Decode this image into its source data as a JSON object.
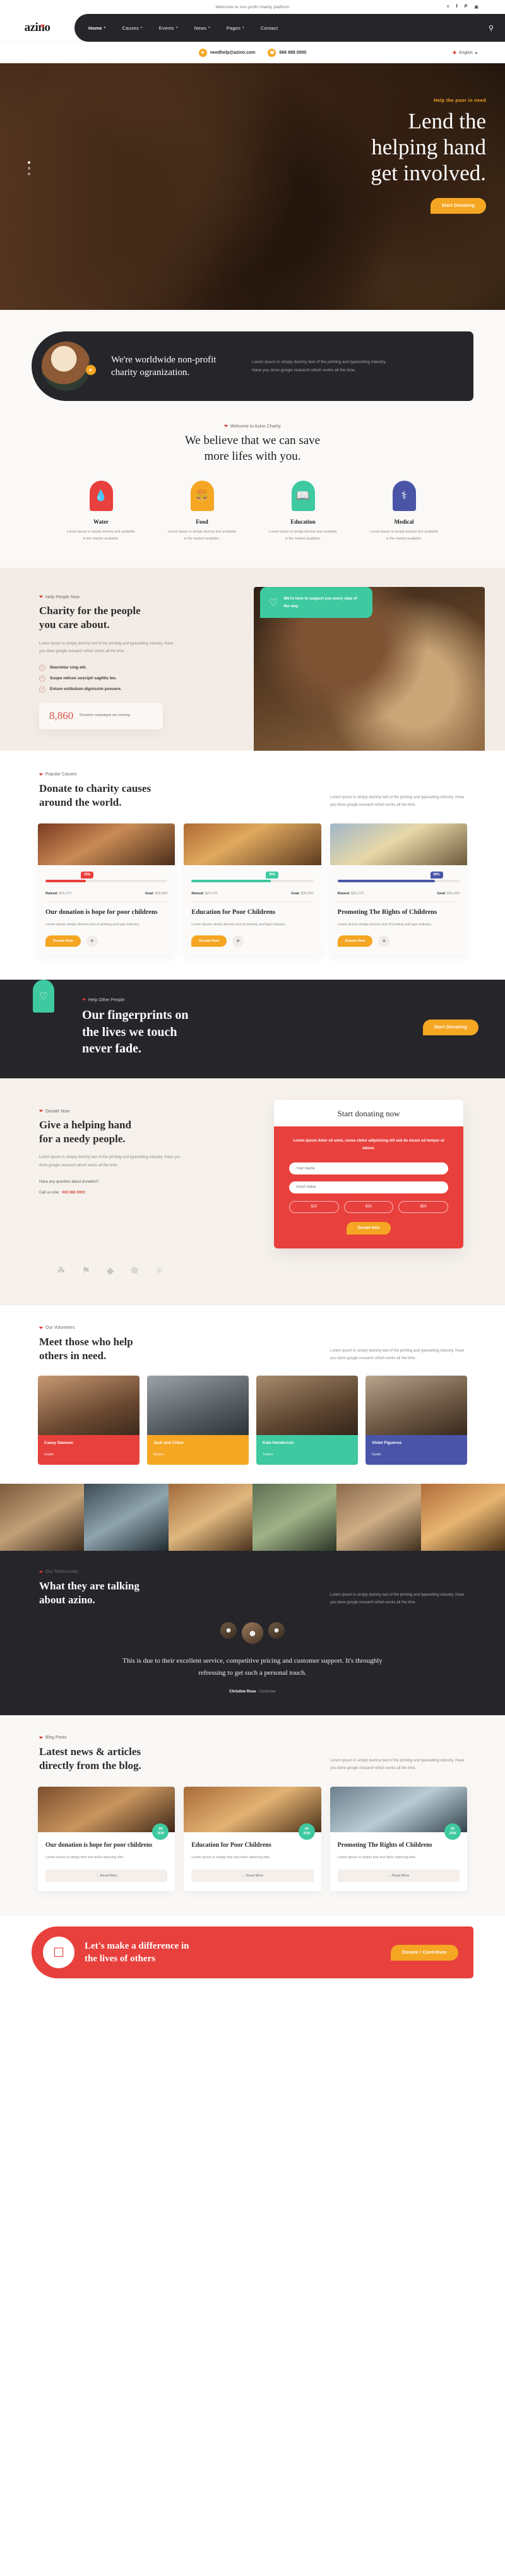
{
  "topbar": {
    "welcome": "Welcome to non profit charity platform",
    "socials": [
      {
        "name": "twitter-icon",
        "glyph": "ᴠ"
      },
      {
        "name": "facebook-icon",
        "glyph": "f"
      },
      {
        "name": "pinterest-icon",
        "glyph": "P"
      },
      {
        "name": "instagram-icon",
        "glyph": "▣"
      }
    ]
  },
  "brand": {
    "name": "azino"
  },
  "nav": {
    "items": [
      {
        "label": "Home",
        "caret": "⌄",
        "active": true
      },
      {
        "label": "Causes",
        "caret": "⌄",
        "active": false
      },
      {
        "label": "Events",
        "caret": "⌄",
        "active": false
      },
      {
        "label": "News",
        "caret": "⌄",
        "active": false
      },
      {
        "label": "Pages",
        "caret": "⌄",
        "active": false
      },
      {
        "label": "Contact",
        "caret": "",
        "active": false
      }
    ],
    "search_icon": "⌕"
  },
  "infobar": {
    "email": "needhelp@azino.com",
    "phone": "666 888 0000",
    "email_icon": "✉",
    "phone_icon": "☎",
    "language": "English",
    "lang_caret": "⌄"
  },
  "hero": {
    "eyebrow": "Help the poor in need",
    "title_line1": "Lend the",
    "title_line2": "helping hand",
    "title_line3": "get involved.",
    "cta": "Start Donating"
  },
  "about": {
    "title": "We're worldwide non-profit charity ogranization.",
    "text": "Lorem Ipsum is simply dummy text of the printing and typesetting industry. Have you done google research which works all the time.",
    "badge_icon": "▶"
  },
  "services": {
    "eyebrow": "Welcome to Azino Charity",
    "title_line1": "We believe that we can save",
    "title_line2": "more lifes with you.",
    "items": [
      {
        "label": "Water",
        "icon": "Ὂ7",
        "color": "#e8403c",
        "desc": "Lorem Ipsum is simply dummy text available in the market available."
      },
      {
        "label": "Food",
        "icon": "ἵ4",
        "color": "#f5a623",
        "desc": "Lorem Ipsum is simply dummy text available in the market available."
      },
      {
        "label": "Education",
        "icon": "Ὅ6",
        "color": "#3ec9a0",
        "desc": "Lorem Ipsum is simply dummy text available in the market available."
      },
      {
        "label": "Medical",
        "icon": "⚕",
        "color": "#4a55a8",
        "desc": "Lorem Ipsum is simply dummy text available in the market available."
      }
    ]
  },
  "charity": {
    "eyebrow": "Help People Now",
    "title_line1": "Charity for the people",
    "title_line2": "you care about.",
    "lead": "Lorem Ipsum is simply dummy text of the printing and typesetting industry. Have you done google research which works all the time.",
    "ticks": [
      "Nsectetur cing elit.",
      "Suspe ndisse suscipit sagittis leo.",
      "Entum estibulum dignissim posuere."
    ],
    "tick_icon": "✓",
    "stat_number": "8,860",
    "stat_label": "Donation campaigns are running",
    "green_text": "We're here to support you every step of the way.",
    "green_icon": "♡"
  },
  "causes": {
    "eyebrow": "Popular Causes",
    "title_line1": "Donate to charity causes",
    "title_line2": "around the world.",
    "headtext": "Lorem Ipsum is simply dummy text of the printing and typesetting industry. Have you done google research which works all the time.",
    "raised_label": "Raised:",
    "goal_label": "Goal:",
    "donate_label": "Donate Now",
    "share_icon": "⛓",
    "cards": [
      {
        "title": "Our donation is hope for poor childrens",
        "desc": "Lorem Ipsum simply dummy text of printing and type industry.",
        "percent": "33%",
        "percent_value": 33,
        "raised": "$25,270",
        "goal": "$30,000",
        "color": "#e8403c"
      },
      {
        "title": "Education for Poor Childrens",
        "desc": "Lorem Ipsum simply dummy text of printing and type industry.",
        "percent": "65%",
        "percent_value": 65,
        "raised": "$25,270",
        "goal": "$30,000",
        "color": "#3ec9a0"
      },
      {
        "title": "Promoting The Rights of Childrens",
        "desc": "Lorem Ipsum simply dummy text of printing and type industry.",
        "percent": "80%",
        "percent_value": 80,
        "raised": "$25,270",
        "goal": "$30,000",
        "color": "#4a55a8"
      }
    ]
  },
  "fingerprints": {
    "eyebrow": "Help Other People",
    "title_line1": "Our fingerprints on",
    "title_line2": "the lives we touch",
    "title_line3": "never fade.",
    "cta": "Start Donating",
    "icon": "ὤc"
  },
  "donate": {
    "eyebrow": "Donate Now",
    "title_line1": "Give a helping hand",
    "title_line2": "for a needy people.",
    "lead": "Lorem Ipsum is simply dummy text of the printing and typesetting industry. Have you done google research which works all the time.",
    "question": "Have any question about donation?",
    "call_prefix": "Call us now",
    "call_number": "666 888 0000",
    "form": {
      "heading": "Start donating now",
      "subtext": "Lorem ipsum dolor sit amet, conse ctetur adipisicing elit sed do eiusm od tempor ut labore.",
      "name_placeholder": "Your Name",
      "value_placeholder": "Insert Value",
      "amounts": [
        "$10",
        "$20",
        "$50"
      ],
      "submit": "Donate Now"
    }
  },
  "team": {
    "eyebrow": "Our Volunteers",
    "title_line1": "Meet those who help",
    "title_line2": "others in need.",
    "headtext": "Lorem Ipsum is simply dummy text of the printing and typesetting industry. Have you done google research which works all the time.",
    "members": [
      {
        "name": "Casey Dawson",
        "role": "Guide",
        "color": "#e8403c"
      },
      {
        "name": "Jack and Chloe",
        "role": "Master",
        "color": "#f5a623"
      },
      {
        "name": "Kale Henderson",
        "role": "Trainer",
        "color": "#3ec9a0"
      },
      {
        "name": "Violet Figueroa",
        "role": "Guide",
        "color": "#4a55a8"
      }
    ]
  },
  "testimonials": {
    "eyebrow": "Our Testimonials",
    "title_line1": "What they are talking",
    "title_line2": "about azino.",
    "headtext": "Lorem Ipsum is simply dummy text of the printing and typesetting industry. Have you done google research which works all the time.",
    "quote": "This is due to their excellent service, competitive pricing and customer support. It's throughly refressing to get such a personal touch.",
    "author": "Christine Rose",
    "author_role": "Customer"
  },
  "blog": {
    "eyebrow": "Blog Posts",
    "title_line1": "Latest news & articles",
    "title_line2": "directly from the blog.",
    "headtext": "Lorem Ipsum is simply dummy text of the printing and typesetting industry. Have you done google research which works all the time.",
    "read_label": "→ Read More",
    "posts": [
      {
        "title": "Our donation is hope for poor childrens",
        "desc": "Lorem ipsum is simply free text dolor sipiscing elitc.",
        "day": "28",
        "month": "JUN"
      },
      {
        "title": "Education for Poor Childrens",
        "desc": "Lorem ipsum is simply free text dolor sipiscing elitc.",
        "day": "24",
        "month": "JUN"
      },
      {
        "title": "Promoting The Rights of Childrens",
        "desc": "Lorem ipsum is simply free text dolor sipiscing elitc.",
        "day": "20",
        "month": "JUN"
      }
    ]
  },
  "cta": {
    "title_line1": "Let's make a difference in",
    "title_line2": "the lives of others",
    "button": "Donate / Contribute",
    "icon": "Ὃ3"
  }
}
